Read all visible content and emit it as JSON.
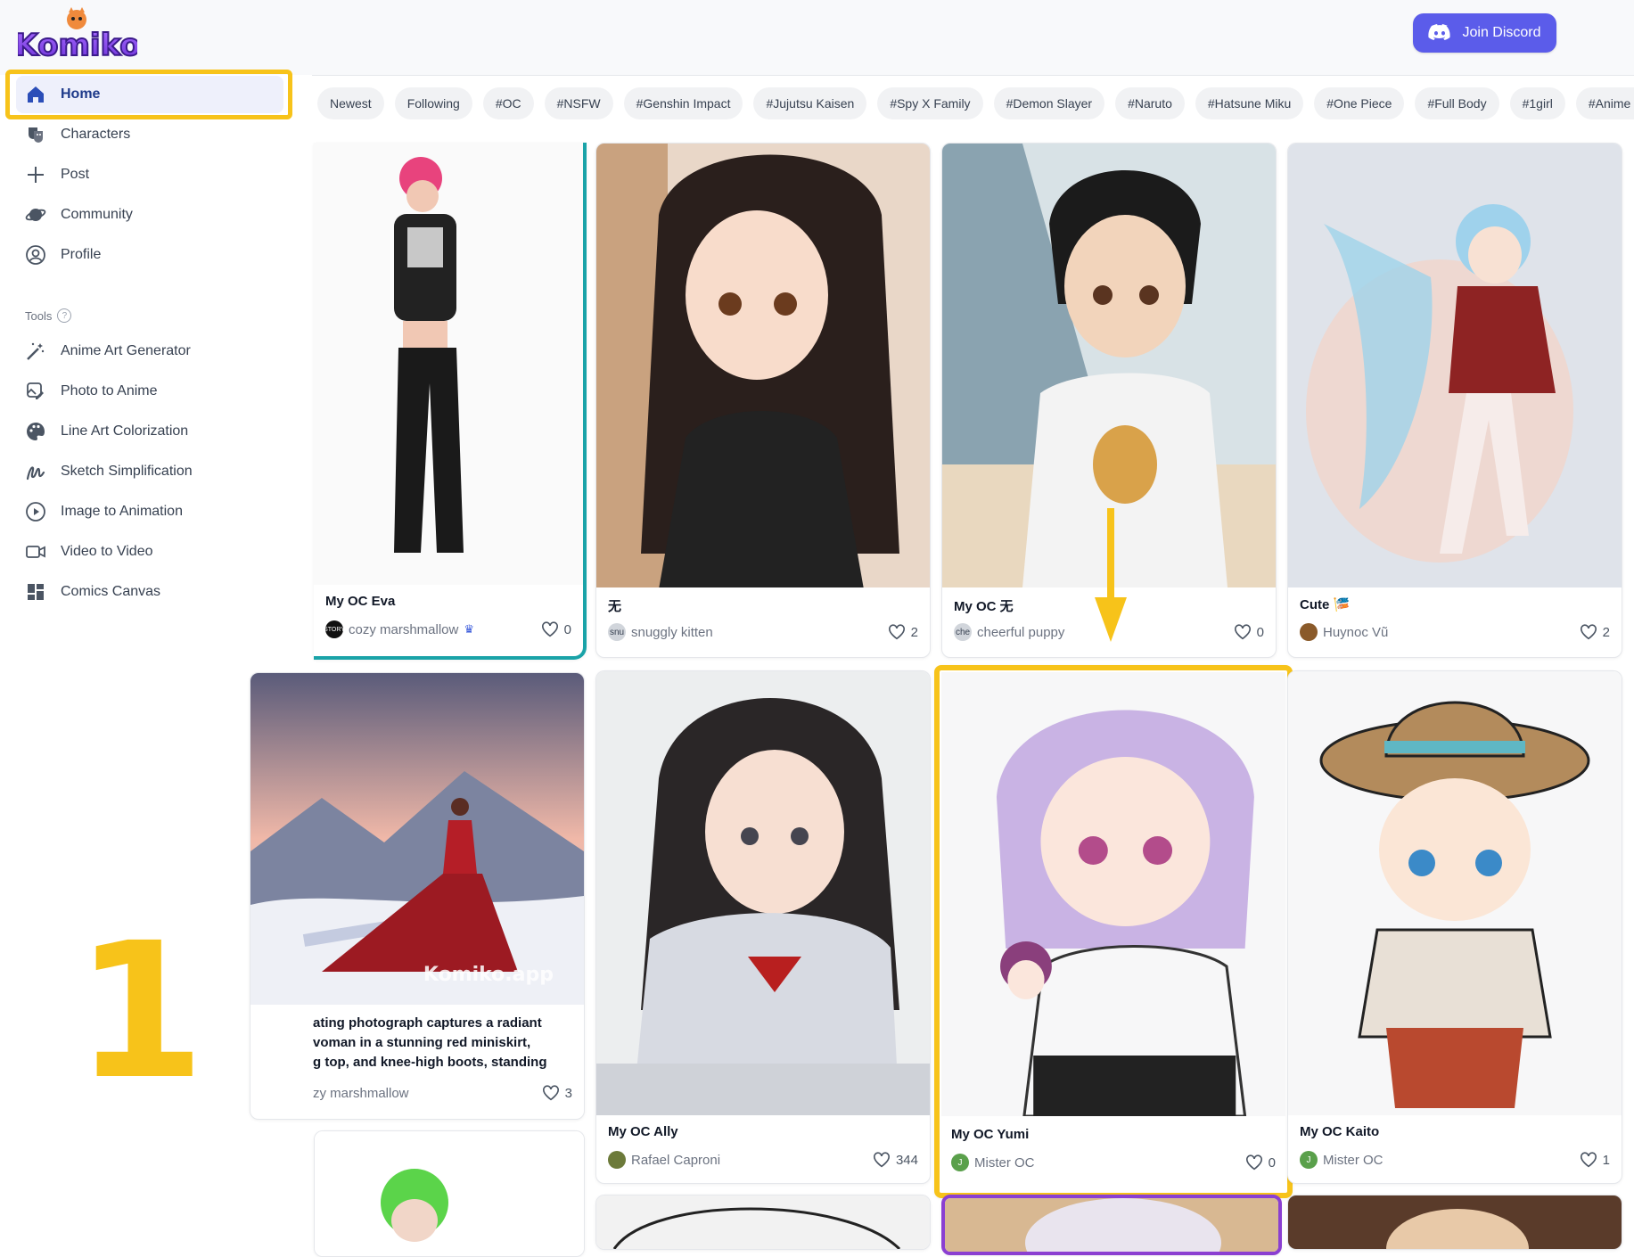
{
  "header": {
    "logo_text": "Komiko",
    "discord_label": "Join Discord"
  },
  "sidebar": {
    "items": [
      {
        "label": "Home",
        "icon": "home-icon"
      },
      {
        "label": "Characters",
        "icon": "characters-icon"
      },
      {
        "label": "Post",
        "icon": "plus-icon"
      },
      {
        "label": "Community",
        "icon": "planet-icon"
      },
      {
        "label": "Profile",
        "icon": "user-circle-icon"
      }
    ],
    "tools_label": "Tools",
    "tools": [
      {
        "label": "Anime Art Generator",
        "icon": "magic-wand-icon"
      },
      {
        "label": "Photo to Anime",
        "icon": "photo-edit-icon"
      },
      {
        "label": "Line Art Colorization",
        "icon": "palette-icon"
      },
      {
        "label": "Sketch Simplification",
        "icon": "sketch-icon"
      },
      {
        "label": "Image to Animation",
        "icon": "play-circle-icon"
      },
      {
        "label": "Video to Video",
        "icon": "video-camera-icon"
      },
      {
        "label": "Comics Canvas",
        "icon": "layout-grid-icon"
      }
    ]
  },
  "annotation_number": "1",
  "tags": [
    "Newest",
    "Following",
    "#OC",
    "#NSFW",
    "#Genshin Impact",
    "#Jujutsu Kaisen",
    "#Spy X Family",
    "#Demon Slayer",
    "#Naruto",
    "#Hatsune Miku",
    "#One Piece",
    "#Full Body",
    "#1girl",
    "#Anime Col"
  ],
  "cards": [
    {
      "title": "My OC Eva",
      "author": "cozy marshmallow",
      "avatar": "STORY",
      "likes": "0"
    },
    {
      "title": "无",
      "author": "snuggly kitten",
      "avatar": "snu",
      "likes": "2"
    },
    {
      "title": "My OC 无",
      "author": "cheerful puppy",
      "avatar": "che",
      "likes": "0"
    },
    {
      "title": "Cute 🎏",
      "author": "Huynoc Vũ",
      "avatar": "",
      "likes": "2"
    },
    {
      "caption_lines": [
        "ating photograph captures a radiant",
        "voman in a stunning red miniskirt,",
        "g top, and knee-high boots, standing"
      ],
      "author": "zy marshmallow",
      "likes": "3"
    },
    {
      "title": "My OC Ally",
      "author": "Rafael Caproni",
      "avatar": "",
      "likes": "344"
    },
    {
      "title": "My OC Yumi",
      "author": "Mister OC",
      "avatar": "J",
      "likes": "0"
    },
    {
      "title": "My OC Kaito",
      "author": "Mister OC",
      "avatar": "J",
      "likes": "1"
    }
  ],
  "watermark": "Komiko.app",
  "colors": {
    "accent": "#5b5cea",
    "highlight": "#f7c31a",
    "teal": "#1aa3a8",
    "purple": "#8b3fd1"
  }
}
